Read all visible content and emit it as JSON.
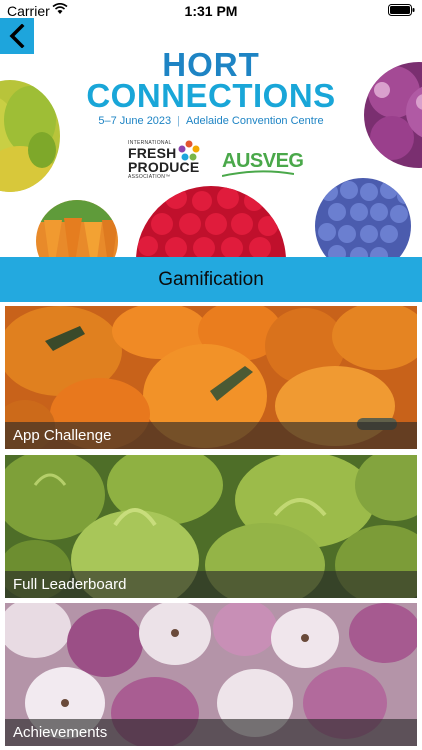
{
  "status_bar": {
    "carrier": "Carrier",
    "time": "1:31 PM"
  },
  "banner": {
    "logo_line1": "HORT",
    "logo_line2": "CONNECTIONS",
    "event_dates": "5–7 June 2023",
    "event_venue": "Adelaide Convention Centre",
    "sponsor1_small": "INTERNATIONAL",
    "sponsor1_line1": "FRESH",
    "sponsor1_line2": "PRODUCE",
    "sponsor1_assoc": "ASSOCIATION™",
    "sponsor2": "AUSVEG"
  },
  "header": {
    "title": "Gamification"
  },
  "tiles": [
    {
      "label": "App Challenge",
      "image": "pumpkins"
    },
    {
      "label": "Full Leaderboard",
      "image": "artichokes"
    },
    {
      "label": "Achievements",
      "image": "turnips"
    }
  ],
  "colors": {
    "accent": "#23a9df",
    "logo_blue": "#1e84c4",
    "caption_bg": "#282828"
  },
  "icons": {
    "back": "chevron-left-icon",
    "wifi": "wifi-icon",
    "battery": "battery-icon"
  }
}
